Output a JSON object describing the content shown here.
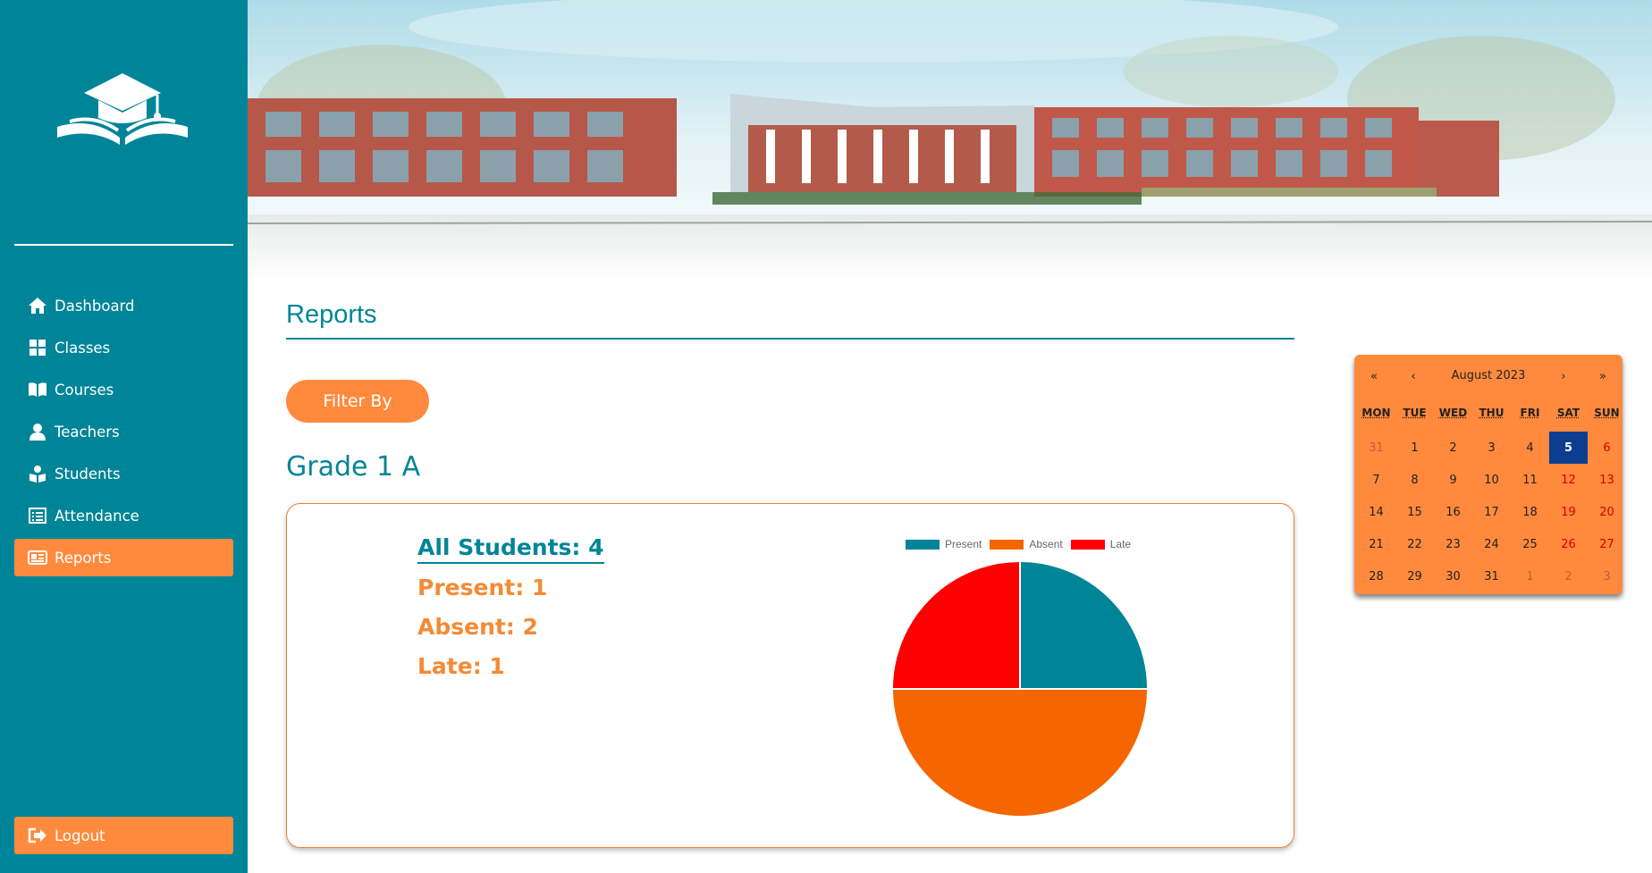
{
  "colors": {
    "sidebar": "#008598",
    "accent": "#ff8a3d",
    "present": "#008598",
    "absent": "#f56600",
    "late": "#ff0000",
    "today": "#0b3d91"
  },
  "sidebar": {
    "logo_icon": "graduation-book-icon",
    "items": [
      {
        "label": "Dashboard",
        "icon": "home-icon"
      },
      {
        "label": "Classes",
        "icon": "grid-icon"
      },
      {
        "label": "Courses",
        "icon": "book-icon"
      },
      {
        "label": "Teachers",
        "icon": "user-icon"
      },
      {
        "label": "Students",
        "icon": "student-icon"
      },
      {
        "label": "Attendance",
        "icon": "list-icon"
      },
      {
        "label": "Reports",
        "icon": "report-icon",
        "active": true
      }
    ],
    "logout": {
      "label": "Logout",
      "icon": "logout-icon"
    }
  },
  "main": {
    "title": "Reports",
    "filter_button": "Filter By",
    "group_title": "Grade 1 A",
    "stats": {
      "all": "All Students: 4",
      "present": "Present: 1",
      "absent": "Absent: 2",
      "late": "Late: 1"
    }
  },
  "chart_data": {
    "type": "pie",
    "categories": [
      "Present",
      "Absent",
      "Late"
    ],
    "values": [
      1,
      2,
      1
    ],
    "colors": [
      "#008598",
      "#f56600",
      "#ff0000"
    ],
    "legend": "top"
  },
  "calendar": {
    "month_label": "August 2023",
    "nav": {
      "prev_year": "«",
      "prev_month": "‹",
      "next_month": "›",
      "next_year": "»"
    },
    "weekdays": [
      "MON",
      "TUE",
      "WED",
      "THU",
      "FRI",
      "SAT",
      "SUN"
    ],
    "today": "5",
    "weeks": [
      [
        "31",
        "1",
        "2",
        "3",
        "4",
        "5",
        "6"
      ],
      [
        "7",
        "8",
        "9",
        "10",
        "11",
        "12",
        "13"
      ],
      [
        "14",
        "15",
        "16",
        "17",
        "18",
        "19",
        "20"
      ],
      [
        "21",
        "22",
        "23",
        "24",
        "25",
        "26",
        "27"
      ],
      [
        "28",
        "29",
        "30",
        "31",
        "1",
        "2",
        "3"
      ]
    ]
  }
}
